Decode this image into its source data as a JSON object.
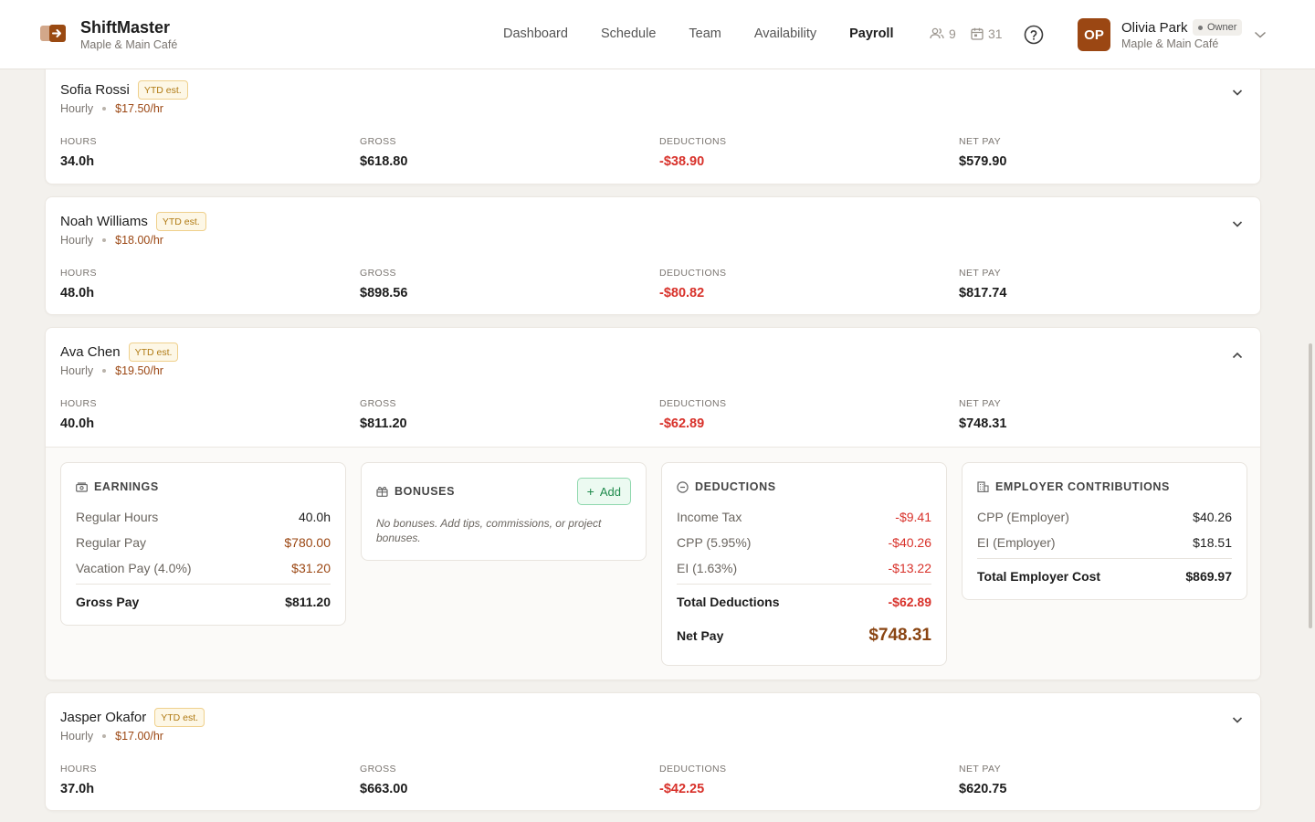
{
  "app": {
    "name": "ShiftMaster",
    "location": "Maple & Main Café"
  },
  "nav": {
    "items": [
      "Dashboard",
      "Schedule",
      "Team",
      "Availability",
      "Payroll"
    ],
    "active": "Payroll"
  },
  "header_stats": {
    "team_count": "9",
    "calendar_count": "31"
  },
  "user": {
    "initials": "OP",
    "name": "Olivia Park",
    "role": "Owner",
    "location": "Maple & Main Café"
  },
  "labels": {
    "hours": "HOURS",
    "gross": "GROSS",
    "deductions": "DEDUCTIONS",
    "net_pay": "NET PAY",
    "ytd": "YTD est."
  },
  "employees": [
    {
      "name": "Sofia Rossi",
      "pay_type": "Hourly",
      "rate": "$17.50/hr",
      "hours": "34.0h",
      "gross": "$618.80",
      "deductions": "-$38.90",
      "net": "$579.90",
      "expanded": false
    },
    {
      "name": "Noah Williams",
      "pay_type": "Hourly",
      "rate": "$18.00/hr",
      "hours": "48.0h",
      "gross": "$898.56",
      "deductions": "-$80.82",
      "net": "$817.74",
      "expanded": false
    },
    {
      "name": "Ava Chen",
      "pay_type": "Hourly",
      "rate": "$19.50/hr",
      "hours": "40.0h",
      "gross": "$811.20",
      "deductions": "-$62.89",
      "net": "$748.31",
      "expanded": true
    },
    {
      "name": "Jasper Okafor",
      "pay_type": "Hourly",
      "rate": "$17.00/hr",
      "hours": "37.0h",
      "gross": "$663.00",
      "deductions": "-$42.25",
      "net": "$620.75",
      "expanded": false
    }
  ],
  "details": {
    "earnings": {
      "title": "EARNINGS",
      "rows": [
        {
          "label": "Regular Hours",
          "value": "40.0h"
        },
        {
          "label": "Regular Pay",
          "value": "$780.00"
        },
        {
          "label": "Vacation Pay (4.0%)",
          "value": "$31.20"
        }
      ],
      "total_label": "Gross Pay",
      "total_value": "$811.20"
    },
    "bonuses": {
      "title": "BONUSES",
      "add_label": "Add",
      "empty_text": "No bonuses. Add tips, commissions, or project bonuses."
    },
    "deductions": {
      "title": "DEDUCTIONS",
      "rows": [
        {
          "label": "Income Tax",
          "value": "-$9.41"
        },
        {
          "label": "CPP (5.95%)",
          "value": "-$40.26"
        },
        {
          "label": "EI (1.63%)",
          "value": "-$13.22"
        }
      ],
      "total_label": "Total Deductions",
      "total_value": "-$62.89",
      "net_label": "Net Pay",
      "net_value": "$748.31"
    },
    "employer": {
      "title": "EMPLOYER CONTRIBUTIONS",
      "rows": [
        {
          "label": "CPP (Employer)",
          "value": "$40.26"
        },
        {
          "label": "EI (Employer)",
          "value": "$18.51"
        }
      ],
      "total_label": "Total Employer Cost",
      "total_value": "$869.97"
    }
  }
}
